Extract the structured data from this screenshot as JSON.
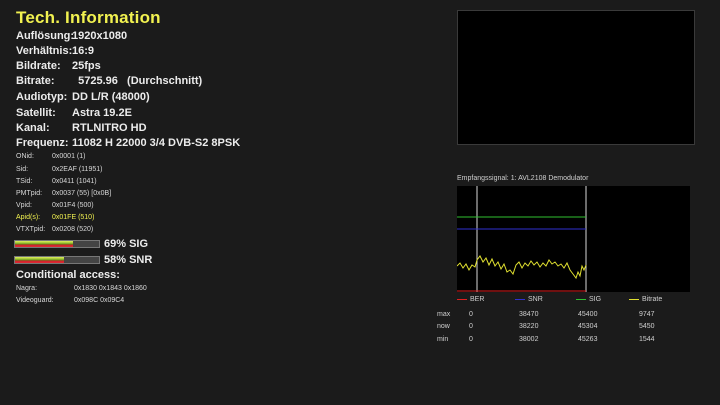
{
  "title": "Tech. Information",
  "info_rows": [
    {
      "label": "Auflösung:",
      "value": "1920x1080"
    },
    {
      "label": "Verhältnis:",
      "value": "16:9"
    },
    {
      "label": "Bildrate:",
      "value": "25fps"
    },
    {
      "label": "Bitrate:",
      "value": "  5725.96   (Durchschnitt)"
    },
    {
      "label": "Audiotyp:",
      "value": "DD L/R (48000)"
    },
    {
      "label": "Satellit:",
      "value": "Astra 19.2E"
    },
    {
      "label": "Kanal:",
      "value": "RTLNITRO HD"
    },
    {
      "label": "Frequenz:",
      "value": "11082 H 22000 3/4 DVB-S2 8PSK"
    }
  ],
  "pid_rows": [
    {
      "label": "ONid:",
      "value": "0x0001 (1)"
    },
    {
      "label": "Sid:",
      "value": "0x2EAF (11951)"
    },
    {
      "label": "TSid:",
      "value": "0x0411 (1041)"
    },
    {
      "label": "PMTpid:",
      "value": "0x0037 (55) [0x0B]"
    },
    {
      "label": "Vpid:",
      "value": "0x01F4 (500)"
    },
    {
      "label": "Apid(s):",
      "value": "0x01FE (510)"
    },
    {
      "label": "VTXTpid:",
      "value": "0x0208 (520)"
    }
  ],
  "meters": [
    {
      "label": "69%  SIG",
      "level": 0.69
    },
    {
      "label": "58%  SNR",
      "level": 0.58
    }
  ],
  "conditional_access": {
    "title": "Conditional access:",
    "rows": [
      {
        "label": "Nagra:",
        "value": "0x1830  0x1843  0x1860"
      },
      {
        "label": "Videoguard:",
        "value": "0x098C  0x09C4"
      }
    ]
  },
  "graph": {
    "title": "Empfangssignal: 1: AVL2108 Demodulator",
    "legend": [
      {
        "label": "BER",
        "color": "#e02020"
      },
      {
        "label": "SNR",
        "color": "#3030d0"
      },
      {
        "label": "SIG",
        "color": "#30c030"
      },
      {
        "label": "Bitrate",
        "color": "#e0e030"
      }
    ],
    "stats": [
      {
        "label": "max",
        "values": [
          "0",
          "38470",
          "45400",
          "9747"
        ]
      },
      {
        "label": "now",
        "values": [
          "0",
          "38220",
          "45304",
          "5450"
        ]
      },
      {
        "label": "min",
        "values": [
          "0",
          "38002",
          "45263",
          "1544"
        ]
      }
    ]
  }
}
